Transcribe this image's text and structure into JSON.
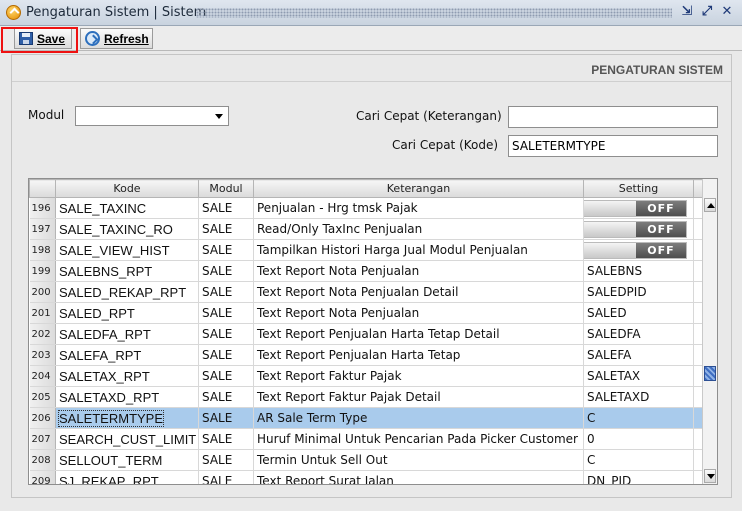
{
  "window": {
    "title": "Pengaturan Sistem | Sistem"
  },
  "toolbar": {
    "save_label": "Save",
    "refresh_label": "Refresh"
  },
  "panel": {
    "heading": "PENGATURAN SISTEM"
  },
  "filters": {
    "modul_label": "Modul",
    "modul_value": "",
    "cari_keterangan_label": "Cari Cepat (Keterangan)",
    "cari_keterangan_value": "",
    "cari_kode_label": "Cari Cepat (Kode)",
    "cari_kode_value": "SALETERMTYPE"
  },
  "table": {
    "columns": [
      "Kode",
      "Modul",
      "Keterangan",
      "Setting"
    ],
    "toggle_off_label": "OFF",
    "rows": [
      {
        "no": "196",
        "kode": "SALE_TAXINC",
        "modul": "SALE",
        "keterangan": "Penjualan - Hrg tmsk Pajak",
        "setting": "OFF",
        "toggle": true
      },
      {
        "no": "197",
        "kode": "SALE_TAXINC_RO",
        "modul": "SALE",
        "keterangan": "Read/Only TaxInc Penjualan",
        "setting": "OFF",
        "toggle": true
      },
      {
        "no": "198",
        "kode": "SALE_VIEW_HIST",
        "modul": "SALE",
        "keterangan": "Tampilkan Histori Harga Jual Modul Penjualan",
        "setting": "OFF",
        "toggle": true
      },
      {
        "no": "199",
        "kode": "SALEBNS_RPT",
        "modul": "SALE",
        "keterangan": "Text Report Nota Penjualan",
        "setting": "SALEBNS",
        "toggle": false
      },
      {
        "no": "200",
        "kode": "SALED_REKAP_RPT",
        "modul": "SALE",
        "keterangan": "Text Report Nota Penjualan Detail",
        "setting": "SALEDPID",
        "toggle": false
      },
      {
        "no": "201",
        "kode": "SALED_RPT",
        "modul": "SALE",
        "keterangan": "Text Report Nota Penjualan",
        "setting": "SALED",
        "toggle": false
      },
      {
        "no": "202",
        "kode": "SALEDFA_RPT",
        "modul": "SALE",
        "keterangan": "Text Report Penjualan Harta Tetap Detail",
        "setting": "SALEDFA",
        "toggle": false
      },
      {
        "no": "203",
        "kode": "SALEFA_RPT",
        "modul": "SALE",
        "keterangan": "Text Report Penjualan Harta Tetap",
        "setting": "SALEFA",
        "toggle": false
      },
      {
        "no": "204",
        "kode": "SALETAX_RPT",
        "modul": "SALE",
        "keterangan": "Text Report Faktur Pajak",
        "setting": "SALETAX",
        "toggle": false
      },
      {
        "no": "205",
        "kode": "SALETAXD_RPT",
        "modul": "SALE",
        "keterangan": "Text Report Faktur Pajak Detail",
        "setting": "SALETAXD",
        "toggle": false
      },
      {
        "no": "206",
        "kode": "SALETERMTYPE",
        "modul": "SALE",
        "keterangan": "AR Sale Term Type",
        "setting": "C",
        "toggle": false,
        "selected": true
      },
      {
        "no": "207",
        "kode": "SEARCH_CUST_LIMIT",
        "modul": "SALE",
        "keterangan": "Huruf Minimal Untuk Pencarian Pada Picker Customer",
        "setting": "0",
        "toggle": false
      },
      {
        "no": "208",
        "kode": "SELLOUT_TERM",
        "modul": "SALE",
        "keterangan": "Termin Untuk Sell Out",
        "setting": "C",
        "toggle": false
      },
      {
        "no": "209",
        "kode": "SJ_REKAP_RPT",
        "modul": "SALE",
        "keterangan": "Text Report Surat Jalan",
        "setting": "DN_PID",
        "toggle": false
      }
    ]
  }
}
